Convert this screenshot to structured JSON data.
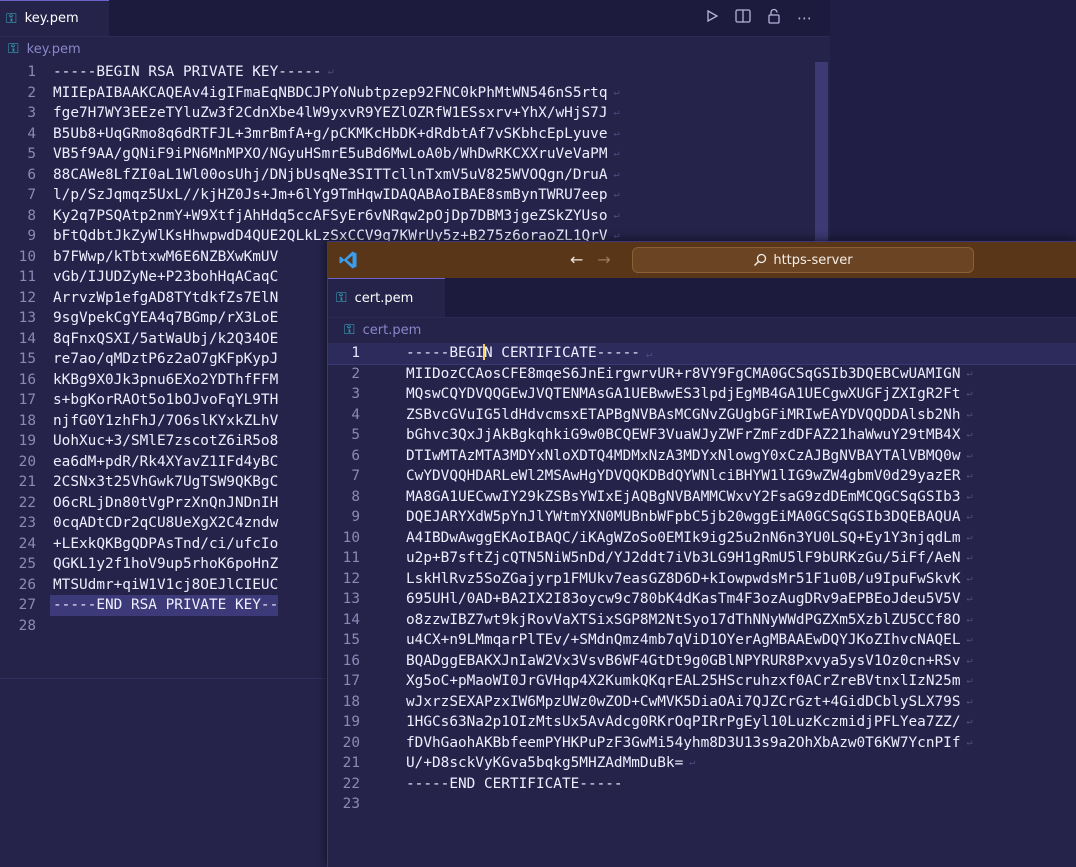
{
  "key_window": {
    "tab_label": "key.pem",
    "breadcrumb": "key.pem",
    "lines": [
      {
        "n": "1",
        "text": "-----BEGIN RSA PRIVATE KEY-----"
      },
      {
        "n": "2",
        "text": "MIIEpAIBAAKCAQEAv4igIFmaEqNBDCJPYoNubtpzep92FNC0kPhMtWN546nS5rtq"
      },
      {
        "n": "3",
        "text": "fge7H7WY3EEzeTYluZw3f2CdnXbe4lW9yxvR9YEZlOZRfW1ESsxrv+YhX/wHjS7J"
      },
      {
        "n": "4",
        "text": "B5Ub8+UqGRmo8q6dRTFJL+3mrBmfA+g/pCKMKcHbDK+dRdbtAf7vSKbhcEpLyuve"
      },
      {
        "n": "5",
        "text": "VB5f9AA/gQNiF9iPN6MnMPXO/NGyuHSmrE5uBd6MwLoA0b/WhDwRKCXXruVeVaPM"
      },
      {
        "n": "6",
        "text": "88CAWe8LfZI0aL1Wl00osUhj/DNjbUsqNe3SITTcllnTxmV5uV825WVOQgn/DruA"
      },
      {
        "n": "7",
        "text": "l/p/SzJqmqz5UxL//kjHZ0Js+Jm+6lYg9TmHqwIDAQABAoIBAE8smBynTWRU7eep"
      },
      {
        "n": "8",
        "text": "Ky2q7PSQAtp2nmY+W9XtfjAhHdq5ccAFSyEr6vNRqw2pOjDp7DBM3jgeZSkZYUso"
      },
      {
        "n": "9",
        "text": "bFtQdbtJkZyWlKsHhwpwdD4QUE2QLkLzSxCCV9q7KWrUy5z+B275z6oraoZL1QrV"
      },
      {
        "n": "10",
        "text": "b7FWwp/kTbtxwM6E6NZBXwKmUV"
      },
      {
        "n": "11",
        "text": "vGb/IJUDZyNe+P23bohHqACaqC"
      },
      {
        "n": "12",
        "text": "ArrvzWp1efgAD8TYtdkfZs7ElN"
      },
      {
        "n": "13",
        "text": "9sgVpekCgYEA4q7BGmp/rX3LoE"
      },
      {
        "n": "14",
        "text": "8qFnxQSXI/5atWaUbj/k2Q34OE"
      },
      {
        "n": "15",
        "text": "re7ao/qMDztP6z2aO7gKFpKypJ"
      },
      {
        "n": "16",
        "text": "kKBg9X0Jk3pnu6EXo2YDThfFFM"
      },
      {
        "n": "17",
        "text": "s+bgKorRAOt5o1bOJvoFqYL9TH"
      },
      {
        "n": "18",
        "text": "njfG0Y1zhFhJ/7O6slKYxkZLhV"
      },
      {
        "n": "19",
        "text": "UohXuc+3/SMlE7zscotZ6iR5o8"
      },
      {
        "n": "20",
        "text": "ea6dM+pdR/Rk4XYavZ1IFd4yBC"
      },
      {
        "n": "21",
        "text": "2CSNx3t25VhGwk7UgTSW9QKBgC"
      },
      {
        "n": "22",
        "text": "O6cRLjDn80tVgPrzXnQnJNDnIH"
      },
      {
        "n": "23",
        "text": "0cqADtCDr2qCU8UeXgX2C4zndw"
      },
      {
        "n": "24",
        "text": "+LExkQKBgQDPAsTnd/ci/ufcIo"
      },
      {
        "n": "25",
        "text": "QGKL1y2f1hoV9up5rhoK6poHnZ"
      },
      {
        "n": "26",
        "text": "MTSUdmr+qiW1V1cj8OEJlCIEUC"
      },
      {
        "n": "27",
        "text": "-----END RSA PRIVATE KEY--"
      },
      {
        "n": "28",
        "text": ""
      }
    ]
  },
  "cert_window": {
    "title": "https-server",
    "tab_label": "cert.pem",
    "breadcrumb": "cert.pem",
    "caret_line_before": "-----BEGI",
    "caret_line_after": "N CERTIFICATE-----",
    "lines": [
      {
        "n": "2",
        "text": "MIIDozCCAosCFE8mqeS6JnEirgwrvUR+r8VY9FgCMA0GCSqGSIb3DQEBCwUAMIGN"
      },
      {
        "n": "3",
        "text": "MQswCQYDVQQGEwJVQTENMAsGA1UEBwwES3lpdjEgMB4GA1UECgwXUGFjZXIgR2Ft"
      },
      {
        "n": "4",
        "text": "ZSBvcGVuIG5ldHdvcmsxETAPBgNVBAsMCGNvZGUgbGFiMRIwEAYDVQQDDAlsb2Nh"
      },
      {
        "n": "5",
        "text": "bGhvc3QxJjAkBgkqhkiG9w0BCQEWF3VuaWJyZWFrZmFzdDFAZ21haWwuY29tMB4X"
      },
      {
        "n": "6",
        "text": "DTIwMTAzMTA3MDYxNloXDTQ4MDMxNzA3MDYxNlowgY0xCzAJBgNVBAYTAlVBMQ0w"
      },
      {
        "n": "7",
        "text": "CwYDVQQHDARLeWl2MSAwHgYDVQQKDBdQYWNlciBHYW1lIG9wZW4gbmV0d29yazER"
      },
      {
        "n": "8",
        "text": "MA8GA1UECwwIY29kZSBsYWIxEjAQBgNVBAMMCWxvY2FsaG9zdDEmMCQGCSqGSIb3"
      },
      {
        "n": "9",
        "text": "DQEJARYXdW5pYnJlYWtmYXN0MUBnbWFpbC5jb20wggEiMA0GCSqGSIb3DQEBAQUA"
      },
      {
        "n": "10",
        "text": "A4IBDwAwggEKAoIBAQC/iKAgWZoSo0EMIk9ig25u2nN6n3YU0LSQ+Ey1Y3njqdLm"
      },
      {
        "n": "11",
        "text": "u2p+B7sftZjcQTN5NiW5nDd/YJ2ddt7iVb3LG9H1gRmU5lF9bURKzGu/5iFf/AeN"
      },
      {
        "n": "12",
        "text": "LskHlRvz5SoZGajyrp1FMUkv7easGZ8D6D+kIowpwdsMr51F1u0B/u9IpuFwSkvK"
      },
      {
        "n": "13",
        "text": "695UHl/0AD+BA2IX2I83oycw9c780bK4dKasTm4F3ozAugDRv9aEPBEoJdeu5V5V"
      },
      {
        "n": "14",
        "text": "o8zzwIBZ7wt9kjRovVaXTSixSGP8M2NtSyo17dThNNyWWdPGZXm5XzblZU5CCf8O"
      },
      {
        "n": "15",
        "text": "u4CX+n9LMmqarPlTEv/+SMdnQmz4mb7qViD1OYerAgMBAAEwDQYJKoZIhvcNAQEL"
      },
      {
        "n": "16",
        "text": "BQADggEBAKXJnIaW2Vx3VsvB6WF4GtDt9g0GBlNPYRUR8Pxvya5ysV1Oz0cn+RSv"
      },
      {
        "n": "17",
        "text": "Xg5oC+pMaoWI0JrGVHqp4X2KumkQKqrEAL25HScruhzxf0ACrZreBVtnxlIzN25m"
      },
      {
        "n": "18",
        "text": "wJxrzSEXAPzxIW6MpzUWz0wZOD+CwMVK5DiaOAi7QJZCrGzt+4GidDCblySLX79S"
      },
      {
        "n": "19",
        "text": "1HGCs63Na2p1OIzMtsUx5AvAdcg0RKrOqPIRrPgEyl10LuzKczmidjPFLYea7ZZ/"
      },
      {
        "n": "20",
        "text": "fDVhGaohAKBbfeemPYHKPuPzF3GwMi54yhm8D3U13s9a2OhXbAzw0T6KW7YcnPIf"
      },
      {
        "n": "21",
        "text": "U/+D8sckVyKGva5bqkg5MHZAdMmDuBk="
      },
      {
        "n": "22",
        "text": "-----END CERTIFICATE-----"
      },
      {
        "n": "23",
        "text": ""
      }
    ]
  },
  "colors": {
    "editor_bg": "#25234a",
    "titlebar_bg": "#5a3618",
    "accent": "#3bb9c6"
  }
}
